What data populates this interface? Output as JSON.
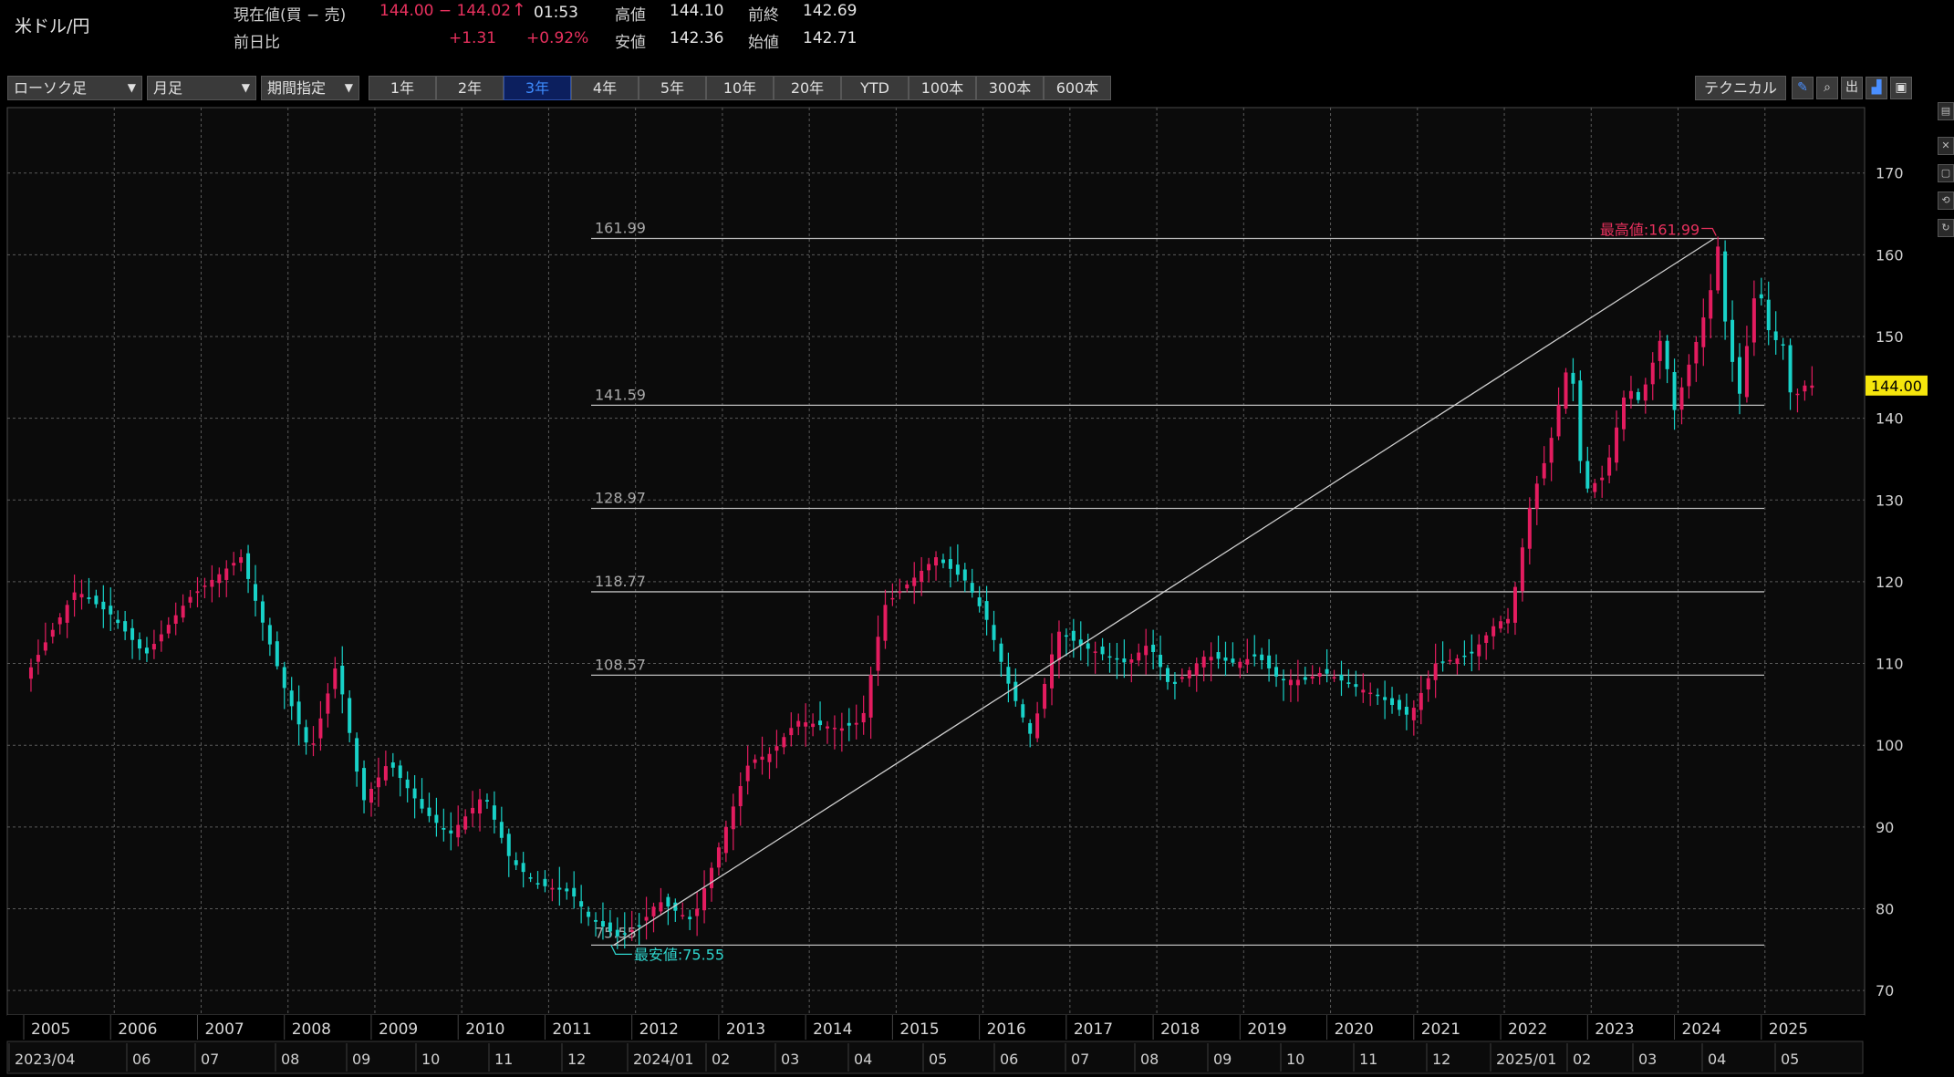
{
  "header": {
    "pair": "米ドル/円",
    "current_label": "現在値(買 − 売)",
    "current_value": "144.00 − 144.02",
    "arrow": "↑",
    "time": "01:53",
    "high_label": "高値",
    "high_value": "144.10",
    "prev_close_label": "前終",
    "prev_close_value": "142.69",
    "change_label": "前日比",
    "change_value": "+1.31",
    "change_pct": "+0.92%",
    "low_label": "安値",
    "low_value": "142.36",
    "open_label": "始値",
    "open_value": "142.71"
  },
  "controls": {
    "chart_type": "ローソク足",
    "period_type": "月足",
    "range_mode": "期間指定",
    "ranges": [
      "1年",
      "2年",
      "3年",
      "4年",
      "5年",
      "10年",
      "20年",
      "YTD",
      "100本",
      "300本",
      "600本"
    ],
    "active_range": "3年",
    "technical": "テクニカル",
    "icons": [
      "pencil-icon",
      "zoom-icon",
      "export-icon",
      "chart-style-icon",
      "save-icon"
    ]
  },
  "colors": {
    "up": "#e31c5f",
    "down": "#18d2c8",
    "current": "#f5e50c",
    "max_label": "#e8315e",
    "min_label": "#2fd4cc"
  },
  "chart_data": {
    "type": "candlestick",
    "title": "",
    "ylim": [
      67,
      178
    ],
    "y_ticks": [
      70,
      80,
      90,
      100,
      110,
      120,
      130,
      140,
      150,
      160,
      170
    ],
    "x_years": [
      "2005",
      "2006",
      "2007",
      "2008",
      "2009",
      "2010",
      "2011",
      "2012",
      "2013",
      "2014",
      "2015",
      "2016",
      "2017",
      "2018",
      "2019",
      "2020",
      "2021",
      "2022",
      "2023",
      "2024",
      "2025"
    ],
    "navigator_labels": [
      "2023/04",
      "06",
      "07",
      "08",
      "09",
      "10",
      "11",
      "12",
      "2024/01",
      "02",
      "03",
      "04",
      "05",
      "06",
      "07",
      "08",
      "09",
      "10",
      "11",
      "12",
      "2025/01",
      "02",
      "03",
      "04",
      "05"
    ],
    "current_price": 144.0,
    "max_label": "最高値:161.99",
    "min_label": "最安値:75.55",
    "fib_levels": [
      161.99,
      141.59,
      128.97,
      118.77,
      108.57,
      75.55
    ],
    "fib_labels": [
      "161.99",
      "141.59",
      "128.97",
      "118.77",
      "108.57",
      "75.55"
    ],
    "trendline": {
      "from": [
        "2011-10",
        75.55
      ],
      "to": [
        "2024-06",
        161.99
      ]
    },
    "anchors": [
      [
        2005.0,
        108
      ],
      [
        2005.6,
        119
      ],
      [
        2006.0,
        116
      ],
      [
        2006.4,
        111
      ],
      [
        2006.9,
        118
      ],
      [
        2007.5,
        123
      ],
      [
        2008.0,
        107
      ],
      [
        2008.3,
        99
      ],
      [
        2008.6,
        110
      ],
      [
        2008.9,
        93
      ],
      [
        2009.2,
        98
      ],
      [
        2009.6,
        92
      ],
      [
        2009.9,
        89
      ],
      [
        2010.3,
        94
      ],
      [
        2010.6,
        86
      ],
      [
        2010.9,
        83
      ],
      [
        2011.3,
        82
      ],
      [
        2011.5,
        79
      ],
      [
        2011.85,
        76.5
      ],
      [
        2012.1,
        78
      ],
      [
        2012.3,
        81
      ],
      [
        2012.7,
        78.5
      ],
      [
        2012.95,
        86
      ],
      [
        2013.35,
        98
      ],
      [
        2013.6,
        99
      ],
      [
        2013.9,
        103
      ],
      [
        2014.4,
        102
      ],
      [
        2014.65,
        103
      ],
      [
        2014.9,
        117
      ],
      [
        2015.2,
        120
      ],
      [
        2015.5,
        123
      ],
      [
        2015.85,
        120
      ],
      [
        2016.1,
        115
      ],
      [
        2016.35,
        107
      ],
      [
        2016.6,
        101
      ],
      [
        2016.9,
        114
      ],
      [
        2017.2,
        112
      ],
      [
        2017.7,
        110
      ],
      [
        2017.95,
        112.5
      ],
      [
        2018.2,
        107
      ],
      [
        2018.6,
        111
      ],
      [
        2018.95,
        110
      ],
      [
        2019.2,
        111
      ],
      [
        2019.45,
        108
      ],
      [
        2019.75,
        108
      ],
      [
        2019.95,
        109
      ],
      [
        2020.25,
        107.5
      ],
      [
        2020.6,
        106
      ],
      [
        2020.95,
        103.5
      ],
      [
        2021.25,
        110
      ],
      [
        2021.65,
        111
      ],
      [
        2021.95,
        115
      ],
      [
        2022.1,
        115.5
      ],
      [
        2022.35,
        130
      ],
      [
        2022.55,
        136
      ],
      [
        2022.8,
        148
      ],
      [
        2022.95,
        131
      ],
      [
        2023.2,
        133
      ],
      [
        2023.45,
        144
      ],
      [
        2023.6,
        142
      ],
      [
        2023.85,
        150
      ],
      [
        2024.0,
        141
      ],
      [
        2024.3,
        151
      ],
      [
        2024.45,
        157
      ],
      [
        2024.5,
        161
      ],
      [
        2024.6,
        150
      ],
      [
        2024.75,
        143
      ],
      [
        2024.85,
        150
      ],
      [
        2024.95,
        157
      ],
      [
        2025.1,
        150
      ],
      [
        2025.25,
        149
      ],
      [
        2025.35,
        142
      ],
      [
        2025.45,
        143.5
      ],
      [
        2025.5,
        144
      ]
    ]
  }
}
